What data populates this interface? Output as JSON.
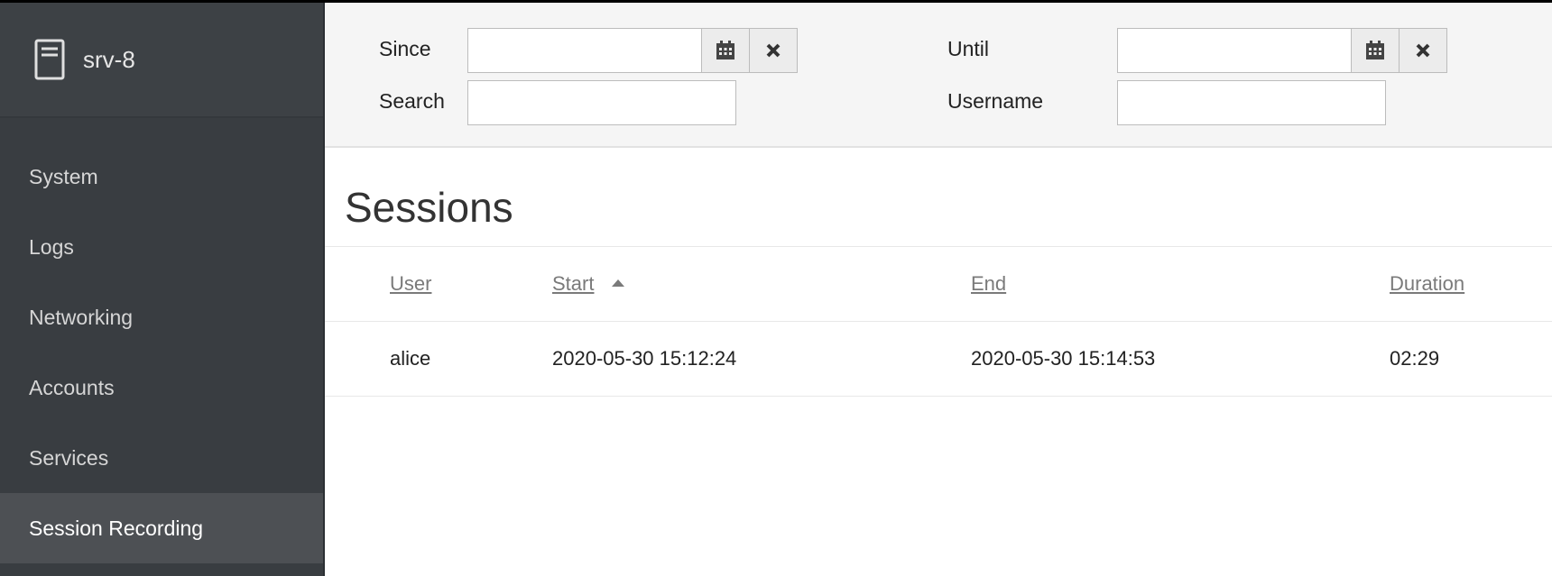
{
  "host": {
    "name": "srv-8",
    "icon": "server-icon"
  },
  "sidebar": {
    "items": [
      {
        "label": "System"
      },
      {
        "label": "Logs"
      },
      {
        "label": "Networking"
      },
      {
        "label": "Accounts"
      },
      {
        "label": "Services"
      },
      {
        "label": "Session Recording",
        "active": true
      }
    ]
  },
  "filters": {
    "since_label": "Since",
    "since_value": "",
    "until_label": "Until",
    "until_value": "",
    "search_label": "Search",
    "search_value": "",
    "username_label": "Username",
    "username_value": ""
  },
  "sessions": {
    "title": "Sessions",
    "columns": [
      "User",
      "Start",
      "End",
      "Duration"
    ],
    "sort": {
      "column": "Start",
      "direction": "ascending"
    },
    "rows": [
      {
        "user": "alice",
        "start": "2020-05-30 15:12:24",
        "end": "2020-05-30 15:14:53",
        "duration": "02:29"
      }
    ]
  },
  "colors": {
    "sidebar_bg": "#393d41",
    "active_bg": "#4d5054",
    "filter_bg": "#f5f5f5"
  }
}
